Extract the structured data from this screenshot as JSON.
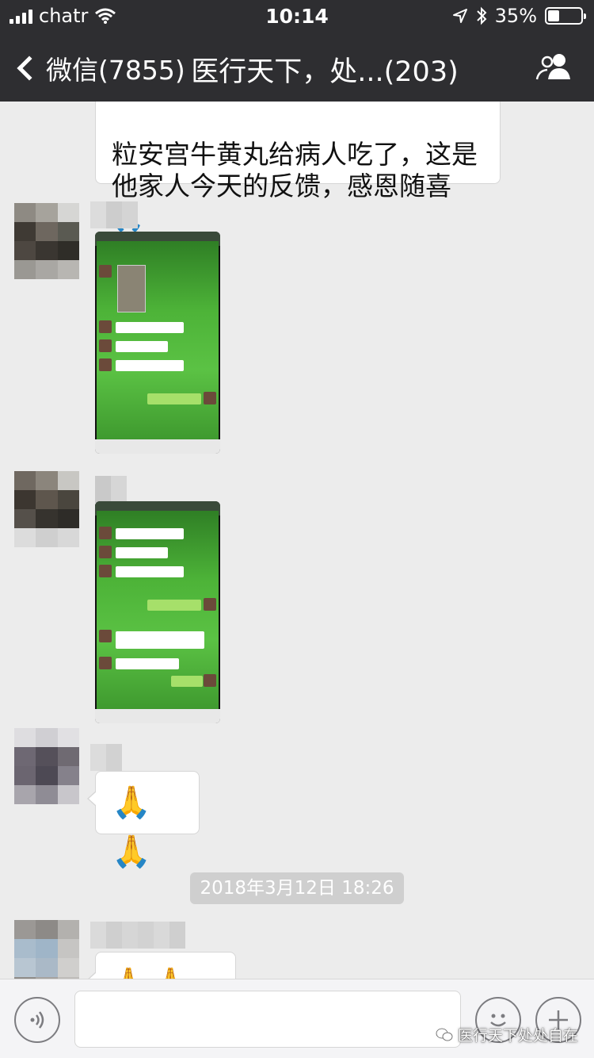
{
  "status_bar": {
    "carrier": "chatr",
    "time": "10:14",
    "battery_percent": "35%",
    "battery_level": 0.35
  },
  "nav": {
    "back_label": "微信(7855)",
    "title": "医行天下，处...(203)"
  },
  "messages": {
    "first_text": "粒安宫牛黄丸给病人吃了，这是\n他家人今天的反馈，感恩随喜🙏",
    "pray_text": "🙏🙏",
    "last_text": "🙏 🙏 🙏"
  },
  "timestamp": "2018年3月12日 18:26",
  "watermark": "医行天下处处自在",
  "icons": {
    "back": "chevron-left-icon",
    "group": "group-members-icon",
    "voice": "voice-icon",
    "emoji": "emoji-icon",
    "plus": "plus-icon",
    "location": "location-arrow-icon",
    "bluetooth": "bluetooth-icon",
    "wifi": "wifi-icon"
  },
  "colors": {
    "nav_bg": "#2e2e31",
    "chat_bg": "#ececec",
    "bubble_bg": "#ffffff",
    "stamp_bg": "#cfcfcf"
  }
}
